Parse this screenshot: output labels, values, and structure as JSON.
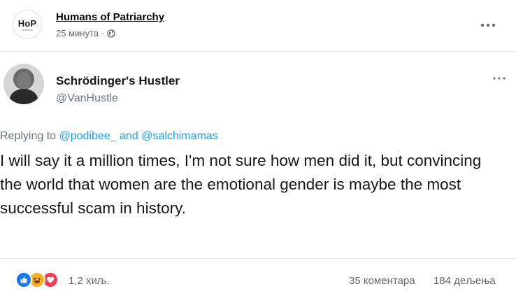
{
  "post": {
    "page_avatar_logo": "HoP",
    "page_name": "Humans of Patriarchy",
    "time": "25 минута",
    "separator": "·",
    "icons": {
      "privacy": "globe-icon",
      "more": "more-horizontal-icon"
    }
  },
  "tweet": {
    "author": "Schrödinger's Hustler",
    "handle": "@VanHustle",
    "reply_prefix": "Replying to",
    "mention_1": "@podibee_",
    "reply_and": "and",
    "mention_2": "@salchimamas",
    "text": "I will say it a million times, I'm not sure how men did it, but convincing the world that women are the emotional gender is maybe the most successful scam in history."
  },
  "footer": {
    "reaction_icons": [
      "like-icon",
      "haha-icon",
      "love-icon"
    ],
    "colors": {
      "like": "#1877f2",
      "haha": "#f7b125",
      "love": "#f33e58"
    },
    "reactions_count": "1,2 хиљ.",
    "comments": "35 коментара",
    "shares": "184 дељења"
  }
}
